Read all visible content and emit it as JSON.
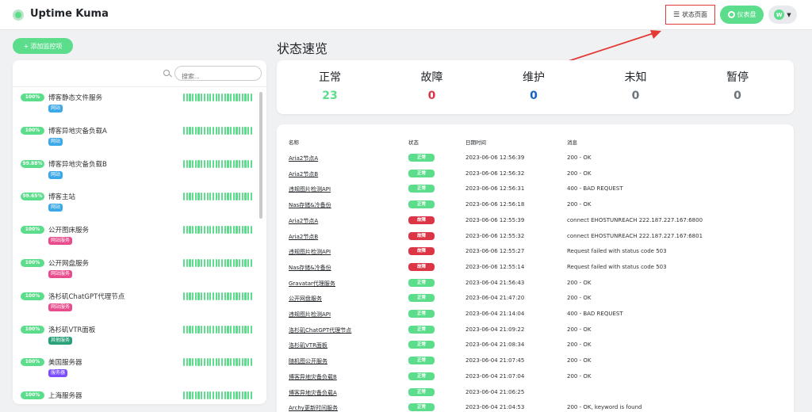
{
  "app": {
    "title": "Uptime Kuma"
  },
  "header": {
    "status_page_label": "状态页面",
    "dashboard_label": "仪表盘",
    "user_initial": "W"
  },
  "colors": {
    "green": "#5cdd8b",
    "red": "#dc3545",
    "blue": "#1565c0",
    "gray": "#6c757d",
    "annotation": "#e53935"
  },
  "left": {
    "add_button": "添加监控项",
    "search_placeholder": "搜索...",
    "monitors": [
      {
        "uptime": "100%",
        "name": "博客静态文件服务",
        "tag": "网站",
        "tag_color": "#3ba8e8"
      },
      {
        "uptime": "100%",
        "name": "博客异地灾备负载A",
        "tag": "网站",
        "tag_color": "#3ba8e8"
      },
      {
        "uptime": "99.88%",
        "name": "博客异地灾备负载B",
        "tag": "网站",
        "tag_color": "#3ba8e8"
      },
      {
        "uptime": "99.65%",
        "name": "博客主站",
        "tag": "网站",
        "tag_color": "#3ba8e8"
      },
      {
        "uptime": "100%",
        "name": "公开图床服务",
        "tag": "网站服务",
        "tag_color": "#e84c8d"
      },
      {
        "uptime": "100%",
        "name": "公开网盘服务",
        "tag": "网站服务",
        "tag_color": "#e84c8d"
      },
      {
        "uptime": "100%",
        "name": "洛杉矶ChatGPT代理节点",
        "tag": "网站服务",
        "tag_color": "#e84c8d"
      },
      {
        "uptime": "100%",
        "name": "洛杉矶VTR面板",
        "tag": "其他服务",
        "tag_color": "#28a07a"
      },
      {
        "uptime": "100%",
        "name": "美国服务器",
        "tag": "服务器",
        "tag_color": "#7c4dff"
      },
      {
        "uptime": "100%",
        "name": "上海服务器",
        "tag": "",
        "tag_color": "#7c4dff"
      }
    ]
  },
  "main": {
    "title": "状态速览",
    "stats": [
      {
        "label": "正常",
        "value": "23",
        "color": "#5cdd8b"
      },
      {
        "label": "故障",
        "value": "0",
        "color": "#dc3545"
      },
      {
        "label": "维护",
        "value": "0",
        "color": "#1565c0"
      },
      {
        "label": "未知",
        "value": "0",
        "color": "#6c757d"
      },
      {
        "label": "暂停",
        "value": "0",
        "color": "#6c757d"
      }
    ],
    "table": {
      "headers": [
        "名称",
        "状态",
        "日期时间",
        "消息"
      ],
      "rows": [
        {
          "name": "Aria2节点A",
          "status": "正常",
          "up": true,
          "time": "2023-06-06 12:56:39",
          "msg": "200 - OK"
        },
        {
          "name": "Aria2节点B",
          "status": "正常",
          "up": true,
          "time": "2023-06-06 12:56:32",
          "msg": "200 - OK"
        },
        {
          "name": "违规图片检测API",
          "status": "正常",
          "up": true,
          "time": "2023-06-06 12:56:31",
          "msg": "400 - BAD REQUEST"
        },
        {
          "name": "Nas存储&冷备份",
          "status": "正常",
          "up": true,
          "time": "2023-06-06 12:56:18",
          "msg": "200 - OK"
        },
        {
          "name": "Aria2节点A",
          "status": "故障",
          "up": false,
          "time": "2023-06-06 12:55:39",
          "msg": "connect EHOSTUNREACH 222.187.227.167:6800"
        },
        {
          "name": "Aria2节点B",
          "status": "故障",
          "up": false,
          "time": "2023-06-06 12:55:32",
          "msg": "connect EHOSTUNREACH 222.187.227.167:6801"
        },
        {
          "name": "违规图片检测API",
          "status": "故障",
          "up": false,
          "time": "2023-06-06 12:55:27",
          "msg": "Request failed with status code 503"
        },
        {
          "name": "Nas存储&冷备份",
          "status": "故障",
          "up": false,
          "time": "2023-06-06 12:55:14",
          "msg": "Request failed with status code 503"
        },
        {
          "name": "Gravatar代理服务",
          "status": "正常",
          "up": true,
          "time": "2023-06-04 21:56:43",
          "msg": "200 - OK"
        },
        {
          "name": "公开网盘服务",
          "status": "正常",
          "up": true,
          "time": "2023-06-04 21:47:20",
          "msg": "200 - OK"
        },
        {
          "name": "违规图片检测API",
          "status": "正常",
          "up": true,
          "time": "2023-06-04 21:14:04",
          "msg": "400 - BAD REQUEST"
        },
        {
          "name": "洛杉矶ChatGPT代理节点",
          "status": "正常",
          "up": true,
          "time": "2023-06-04 21:09:22",
          "msg": "200 - OK"
        },
        {
          "name": "洛杉矶VTR面板",
          "status": "正常",
          "up": true,
          "time": "2023-06-04 21:08:34",
          "msg": "200 - OK"
        },
        {
          "name": "随机图公开服务",
          "status": "正常",
          "up": true,
          "time": "2023-06-04 21:07:45",
          "msg": "200 - OK"
        },
        {
          "name": "博客异地灾备负载B",
          "status": "正常",
          "up": true,
          "time": "2023-06-04 21:07:04",
          "msg": "200 - OK"
        },
        {
          "name": "博客异地灾备负载A",
          "status": "正常",
          "up": true,
          "time": "2023-06-04 21:06:25",
          "msg": ""
        },
        {
          "name": "Archy更新时间服务",
          "status": "正常",
          "up": true,
          "time": "2023-06-04 21:04:53",
          "msg": "200 - OK, keyword is found"
        }
      ]
    }
  }
}
